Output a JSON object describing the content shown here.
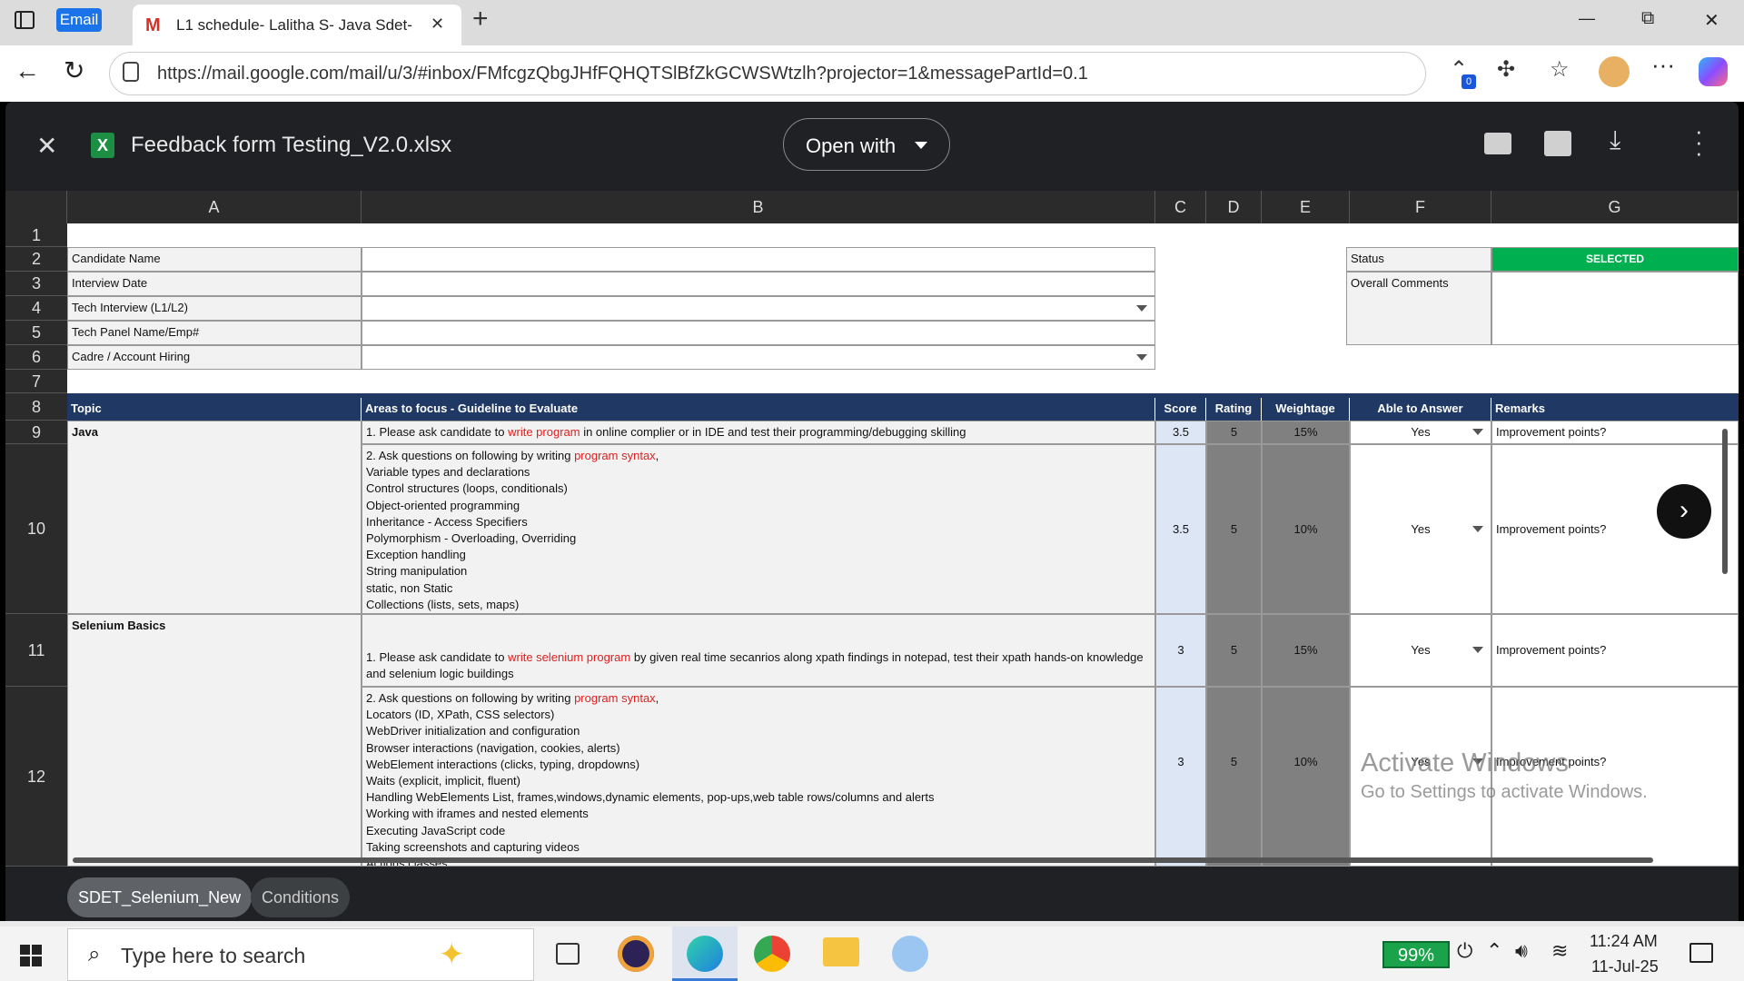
{
  "browser": {
    "email_badge": "Email",
    "tab_title": "L1 schedule- Lalitha S- Java Sdet-",
    "close_tab": "✕",
    "new_tab": "+",
    "url": "https://mail.google.com/mail/u/3/#inbox/FMfcgzQbgJHfFQHQTSlBfZkGCWSWtzlh?projector=1&messagePartId=0.1",
    "ext_badge": "0",
    "win_minimize": "—",
    "win_restore": "⧉",
    "win_close": "✕"
  },
  "viewer": {
    "file_title": "Feedback form Testing_V2.0.xlsx",
    "file_icon_letter": "X",
    "open_with": "Open with",
    "close": "✕"
  },
  "columns": [
    "A",
    "B",
    "C",
    "D",
    "E",
    "F",
    "G"
  ],
  "rows": [
    "1",
    "2",
    "3",
    "4",
    "5",
    "6",
    "7",
    "8",
    "9",
    "10",
    "11",
    "12"
  ],
  "form": {
    "candidate_name": "Candidate Name",
    "interview_date": "Interview Date",
    "tech_interview": "Tech Interview (L1/L2)",
    "tech_panel": "Tech Panel Name/Emp#",
    "cadre": "Cadre / Account Hiring",
    "status_label": "Status",
    "status_value": "SELECTED",
    "overall_comments": "Overall Comments"
  },
  "table_headers": {
    "topic": "Topic",
    "areas": "Areas to focus - Guideline to Evaluate",
    "score": "Score",
    "rating": "Rating",
    "weightage": "Weightage",
    "able": "Able to Answer",
    "remarks": "Remarks"
  },
  "r9": {
    "topic": "Java",
    "t1": "1. Please ask candidate to ",
    "t2": "write program",
    "t3": " in online complier or in IDE and test their programming/debugging skilling",
    "score": "3.5",
    "rating": "5",
    "weight": "15%",
    "able": "Yes",
    "remarks": "Improvement points?"
  },
  "r10": {
    "t1": "2. Ask questions on following by writing ",
    "t2": "program syntax",
    "t3": ",",
    "lines": [
      "Variable types and declarations",
      "Control structures (loops, conditionals)",
      "Object-oriented programming",
      "Inheritance - Access Specifiers",
      "Polymorphism - Overloading, Overriding",
      "Exception handling",
      "String manipulation",
      "static, non Static",
      "Collections (lists, sets, maps)"
    ],
    "score": "3.5",
    "rating": "5",
    "weight": "10%",
    "able": "Yes",
    "remarks": "Improvement points?"
  },
  "r11": {
    "topic": "Selenium Basics",
    "t1": "1. Please ask candidate to ",
    "t2": "write selenium program",
    "t3": " by given real time secanrios along xpath findings in notepad, test their xpath hands-on knowledge and selenium logic buildings",
    "score": "3",
    "rating": "5",
    "weight": "15%",
    "able": "Yes",
    "remarks": "Improvement points?"
  },
  "r12": {
    "t1": "2. Ask questions on following by writing ",
    "t2": "program syntax",
    "t3": ",",
    "lines": [
      "Locators (ID, XPath, CSS selectors)",
      "WebDriver initialization and configuration",
      "Browser interactions (navigation, cookies, alerts)",
      "WebElement interactions (clicks, typing, dropdowns)",
      "Waits (explicit, implicit, fluent)",
      "Handling WebElements List, frames,windows,dynamic elements, pop-ups,web table rows/columns and alerts",
      "Working with iframes and nested elements",
      "Executing JavaScript code",
      "Taking screenshots and capturing videos",
      "Actions classes"
    ],
    "score": "3",
    "rating": "5",
    "weight": "10%",
    "able": "Yes",
    "remarks": "Improvement points?"
  },
  "sheets": [
    "SDET_Selenium_New",
    "Conditions"
  ],
  "watermark": {
    "line1": "Activate Windows",
    "line2": "Go to Settings to activate Windows."
  },
  "taskbar": {
    "search_placeholder": "Type here to search",
    "battery": "99%",
    "time": "11:24 AM",
    "date": "11-Jul-25"
  }
}
